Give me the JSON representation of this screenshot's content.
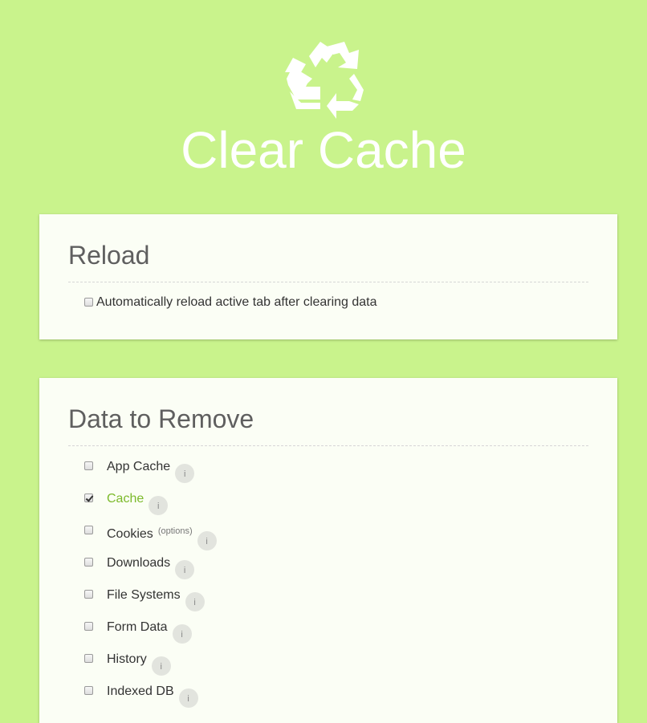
{
  "app": {
    "title": "Clear Cache",
    "logo_icon": "recycle-icon",
    "background_color": "#c9f38c",
    "accent_color": "#7cba2b"
  },
  "reload_section": {
    "title": "Reload",
    "option_label": "Automatically reload active tab after clearing data",
    "checked": false
  },
  "data_section": {
    "title": "Data to Remove",
    "items": [
      {
        "label": "App Cache",
        "checked": false,
        "info": "i"
      },
      {
        "label": "Cache",
        "checked": true,
        "info": "i"
      },
      {
        "label": "Cookies",
        "checked": false,
        "options_label": "(options)",
        "info": "i"
      },
      {
        "label": "Downloads",
        "checked": false,
        "info": "i"
      },
      {
        "label": "File Systems",
        "checked": false,
        "info": "i"
      },
      {
        "label": "Form Data",
        "checked": false,
        "info": "i"
      },
      {
        "label": "History",
        "checked": false,
        "info": "i"
      },
      {
        "label": "Indexed DB",
        "checked": false,
        "info": "i"
      }
    ]
  }
}
